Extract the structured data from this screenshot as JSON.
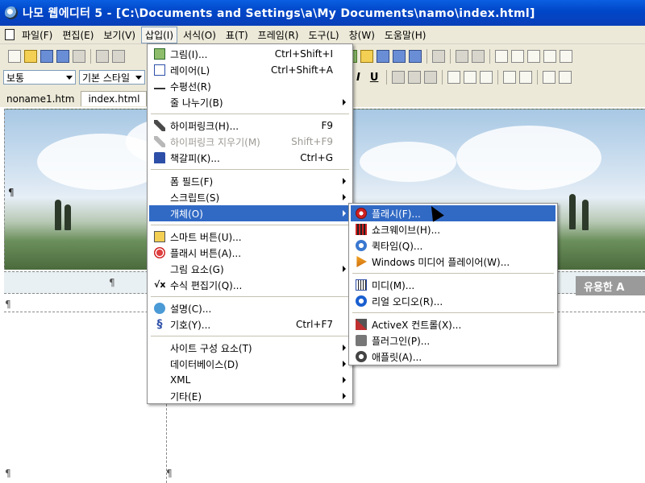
{
  "window": {
    "title": "나모 웹에디터 5 - [C:\\Documents and Settings\\a\\My Documents\\namo\\index.html]"
  },
  "menubar": [
    {
      "label": "파일(F)"
    },
    {
      "label": "편집(E)"
    },
    {
      "label": "보기(V)"
    },
    {
      "label": "삽입(I)",
      "active": true
    },
    {
      "label": "서식(O)"
    },
    {
      "label": "표(T)"
    },
    {
      "label": "프레임(R)"
    },
    {
      "label": "도구(L)"
    },
    {
      "label": "창(W)"
    },
    {
      "label": "도움말(H)"
    }
  ],
  "toolbar2": {
    "paragraph_style": "보통",
    "base_style": "기본 스타일",
    "format_buttons": [
      "I",
      "U"
    ]
  },
  "doc_tabs": [
    {
      "label": "noname1.htm"
    },
    {
      "label": "index.html",
      "active": true
    }
  ],
  "page": {
    "nav_button": "유용한 A",
    "para_mark": "¶"
  },
  "insert_menu": [
    {
      "label": "그림(I)...",
      "shortcut": "Ctrl+Shift+I",
      "icon": "picture-icon"
    },
    {
      "label": "레이어(L)",
      "shortcut": "Ctrl+Shift+A",
      "icon": "layer-icon"
    },
    {
      "label": "수평선(R)",
      "icon": "horizontal-rule-icon"
    },
    {
      "label": "줄 나누기(B)",
      "submenu": true
    },
    {
      "label": "하이퍼링크(H)...",
      "shortcut": "F9",
      "icon": "hyperlink-icon"
    },
    {
      "label": "하이퍼링크 지우기(M)",
      "shortcut": "Shift+F9",
      "icon": "remove-hyperlink-icon",
      "disabled": true
    },
    {
      "label": "책갈피(K)...",
      "shortcut": "Ctrl+G",
      "icon": "bookmark-icon"
    },
    {
      "label": "폼 필드(F)",
      "submenu": true
    },
    {
      "label": "스크립트(S)",
      "submenu": true
    },
    {
      "label": "개체(O)",
      "submenu": true,
      "selected": true
    },
    {
      "label": "스마트 버튼(U)...",
      "icon": "smart-button-icon"
    },
    {
      "label": "플래시 버튼(A)...",
      "icon": "flash-button-icon"
    },
    {
      "label": "그림 요소(G)",
      "submenu": true
    },
    {
      "label": "수식 편집기(Q)...",
      "icon": "formula-icon"
    },
    {
      "label": "설명(C)...",
      "icon": "comment-icon"
    },
    {
      "label": "기호(Y)...",
      "shortcut": "Ctrl+F7",
      "icon": "symbol-icon"
    },
    {
      "label": "사이트 구성 요소(T)",
      "submenu": true
    },
    {
      "label": "데이터베이스(D)",
      "submenu": true
    },
    {
      "label": "XML",
      "submenu": true
    },
    {
      "label": "기타(E)",
      "submenu": true
    }
  ],
  "object_submenu": [
    {
      "label": "플래시(F)...",
      "icon": "flash-icon",
      "selected": true
    },
    {
      "label": "쇼크웨이브(H)...",
      "icon": "shockwave-icon"
    },
    {
      "label": "퀵타임(Q)...",
      "icon": "quicktime-icon"
    },
    {
      "label": "Windows 미디어 플레이어(W)...",
      "icon": "windows-media-player-icon"
    },
    {
      "label": "미디(M)...",
      "icon": "midi-icon"
    },
    {
      "label": "리얼 오디오(R)...",
      "icon": "real-audio-icon"
    },
    {
      "label": "ActiveX 컨트롤(X)...",
      "icon": "activex-icon"
    },
    {
      "label": "플러그인(P)...",
      "icon": "plugin-icon"
    },
    {
      "label": "애플릿(A)...",
      "icon": "applet-icon"
    }
  ],
  "colors": {
    "title_bar": "#0046c8",
    "menu_highlight": "#316ac5",
    "chrome": "#ece9d8"
  }
}
